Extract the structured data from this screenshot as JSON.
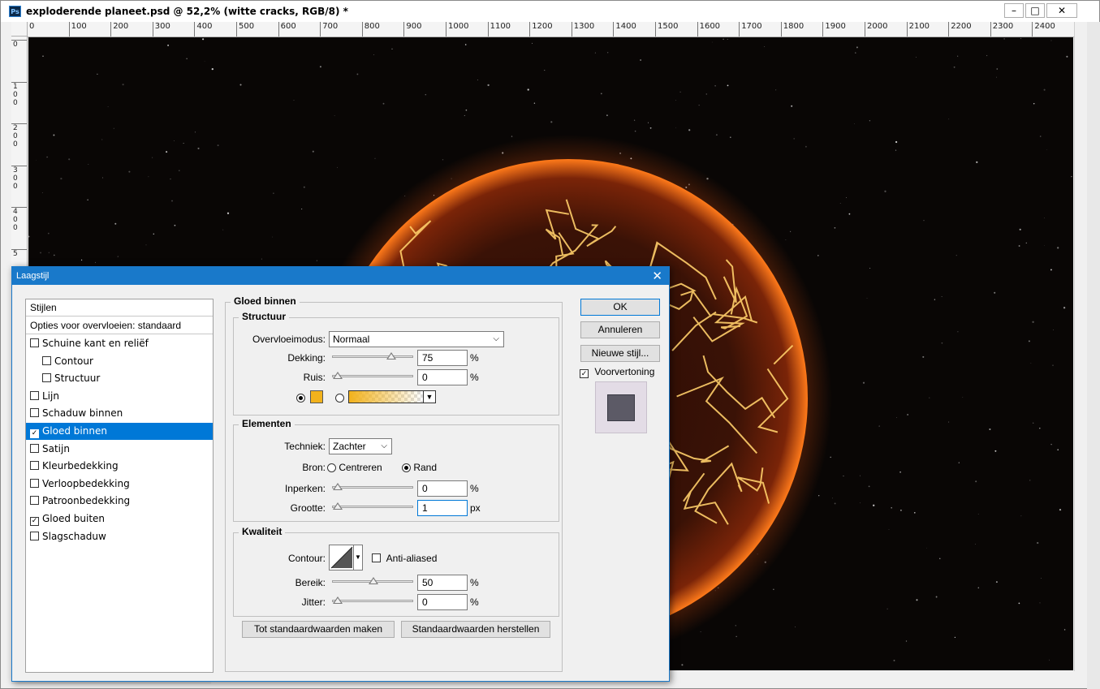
{
  "window": {
    "title": "exploderende planeet.psd @ 52,2% (witte cracks, RGB/8) *",
    "app_icon": "Ps",
    "minimize": "–",
    "maximize": "□",
    "close": "✕"
  },
  "ruler": {
    "h_labels": [
      "0",
      "100",
      "200",
      "300",
      "400",
      "500",
      "600",
      "700",
      "800",
      "900",
      "1000",
      "1100",
      "1200",
      "1300",
      "1400",
      "1500",
      "1600",
      "1700",
      "1800",
      "1900",
      "2000",
      "2100",
      "2200",
      "2300",
      "2400"
    ],
    "v_labels": [
      "0",
      "1\n0\n0",
      "2\n0\n0",
      "3\n0\n0",
      "4\n0\n0",
      "5"
    ]
  },
  "dialog": {
    "title": "Laagstijl",
    "close": "✕",
    "styles_header": "Stijlen",
    "blend_options": "Opties voor overvloeien: standaard",
    "styles": [
      {
        "label": "Schuine kant en reliëf",
        "checked": false,
        "indent": false,
        "selected": false
      },
      {
        "label": "Contour",
        "checked": false,
        "indent": true,
        "selected": false
      },
      {
        "label": "Structuur",
        "checked": false,
        "indent": true,
        "selected": false
      },
      {
        "label": "Lijn",
        "checked": false,
        "indent": false,
        "selected": false
      },
      {
        "label": "Schaduw binnen",
        "checked": false,
        "indent": false,
        "selected": false
      },
      {
        "label": "Gloed binnen",
        "checked": true,
        "indent": false,
        "selected": true
      },
      {
        "label": "Satijn",
        "checked": false,
        "indent": false,
        "selected": false
      },
      {
        "label": "Kleurbedekking",
        "checked": false,
        "indent": false,
        "selected": false
      },
      {
        "label": "Verloopbedekking",
        "checked": false,
        "indent": false,
        "selected": false
      },
      {
        "label": "Patroonbedekking",
        "checked": false,
        "indent": false,
        "selected": false
      },
      {
        "label": "Gloed buiten",
        "checked": true,
        "indent": false,
        "selected": false
      },
      {
        "label": "Slagschaduw",
        "checked": false,
        "indent": false,
        "selected": false
      }
    ],
    "panel_title": "Gloed binnen",
    "structuur": {
      "title": "Structuur",
      "blend_mode_label": "Overvloeimodus:",
      "blend_mode_value": "Normaal",
      "opacity_label": "Dekking:",
      "opacity_value": "75",
      "opacity_unit": "%",
      "opacity_level": 75,
      "noise_label": "Ruis:",
      "noise_value": "0",
      "noise_unit": "%",
      "noise_level": 0,
      "glow_color": "#f2b21c",
      "gradient_color": "#f2b21c"
    },
    "elementen": {
      "title": "Elementen",
      "technique_label": "Techniek:",
      "technique_value": "Zachter",
      "source_label": "Bron:",
      "source_center": "Centreren",
      "source_edge": "Rand",
      "choke_label": "Inperken:",
      "choke_value": "0",
      "choke_unit": "%",
      "choke_level": 0,
      "size_label": "Grootte:",
      "size_value": "1",
      "size_unit": "px",
      "size_level": 0.4
    },
    "kwaliteit": {
      "title": "Kwaliteit",
      "contour_label": "Contour:",
      "anti_aliased_label": "Anti-aliased",
      "range_label": "Bereik:",
      "range_value": "50",
      "range_unit": "%",
      "range_level": 50,
      "jitter_label": "Jitter:",
      "jitter_value": "0",
      "jitter_unit": "%",
      "jitter_level": 0
    },
    "make_default": "Tot standaardwaarden maken",
    "reset_default": "Standaardwaarden herstellen",
    "ok": "OK",
    "cancel": "Annuleren",
    "new_style": "Nieuwe stijl...",
    "preview_label": "Voorvertoning"
  }
}
